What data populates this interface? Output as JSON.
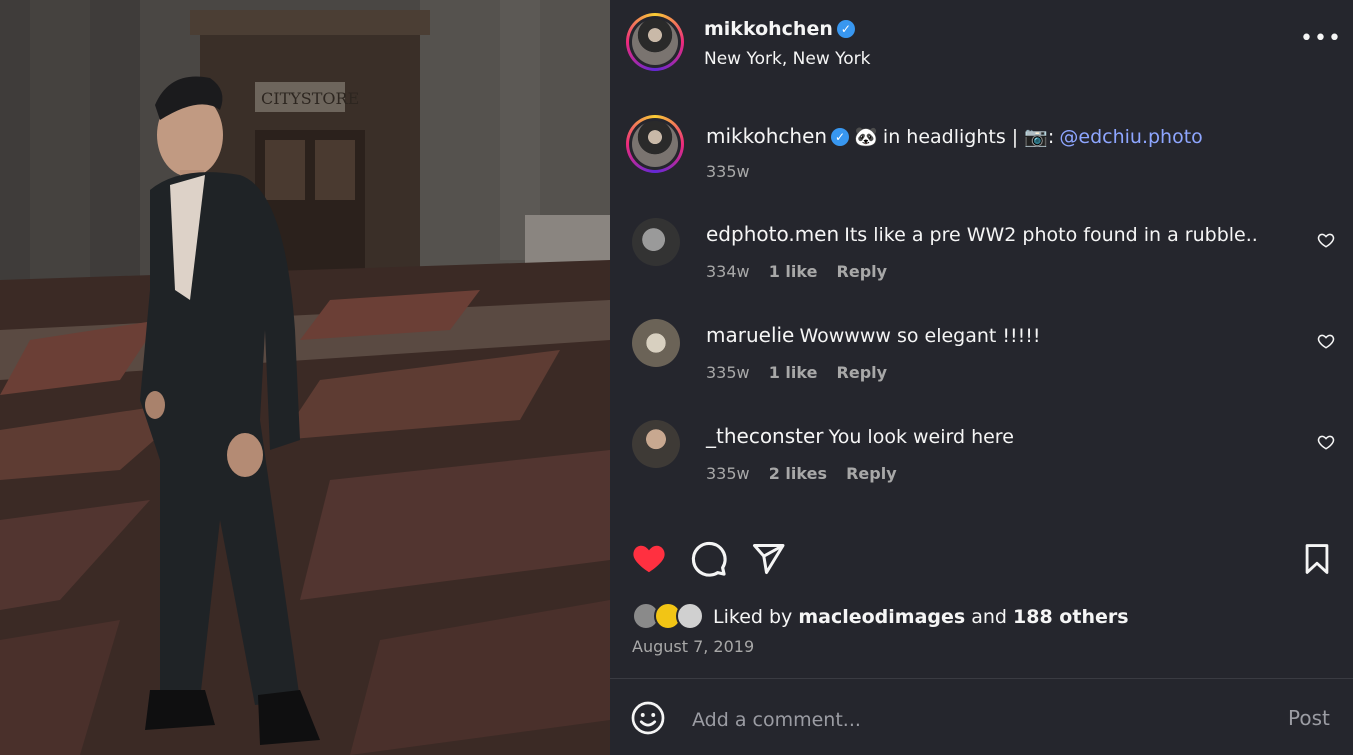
{
  "post": {
    "username": "mikkohchen",
    "location": "New York, New York",
    "more_icon": "more-horizontal-icon"
  },
  "caption": {
    "username": "mikkohchen",
    "emoji": "🐼",
    "text_before": "in headlights | ",
    "camera_emoji": "📷",
    "colon": ":",
    "mention": "@edchiu.photo",
    "time": "335w"
  },
  "comments": [
    {
      "username": "edphoto.men",
      "text": "Its like a pre WW2 photo found in a rubble..",
      "time": "334w",
      "likes": "1 like",
      "reply": "Reply"
    },
    {
      "username": "maruelie",
      "text": "Wowwww so elegant !!!!!",
      "time": "335w",
      "likes": "1 like",
      "reply": "Reply"
    },
    {
      "username": "_theconster",
      "text": "You look weird here",
      "time": "335w",
      "likes": "2 likes",
      "reply": "Reply"
    }
  ],
  "actions": {
    "like_icon": "heart-filled-icon",
    "comment_icon": "comment-icon",
    "share_icon": "share-icon",
    "save_icon": "bookmark-icon",
    "like_color": "#ff3040"
  },
  "likes": {
    "prefix": "Liked by ",
    "user": "macleodimages",
    "middle": " and ",
    "others": "188 others"
  },
  "date": "August 7, 2019",
  "composer": {
    "emoji_icon": "smiley-icon",
    "placeholder": "Add a comment...",
    "post_label": "Post"
  },
  "photo": {
    "sign_text": "CITYSTORE"
  }
}
